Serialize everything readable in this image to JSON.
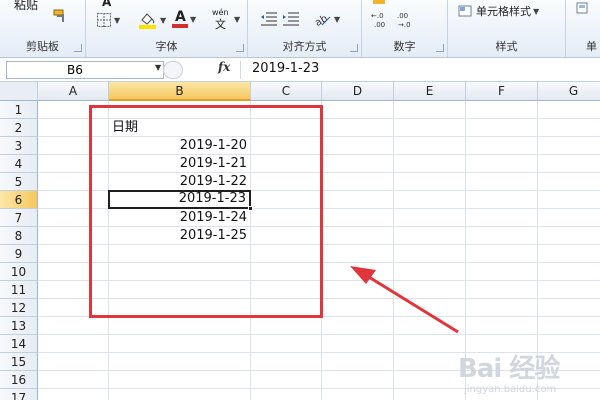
{
  "ribbon": {
    "paste_label": "粘贴",
    "groups": {
      "clipboard": "剪贴板",
      "font": "字体",
      "alignment": "对齐方式",
      "number": "数字",
      "styles": "样式",
      "cells_partial": "单"
    },
    "cell_styles_label": "单元格样式",
    "font_sample_a": "A",
    "font_color_a": "A",
    "wen_label": "wén",
    "wen_char": "文",
    "colors": {
      "font_red": "#d32f2f",
      "fill_yellow": "#ffe100",
      "accent": "#2b579a"
    }
  },
  "formula_bar": {
    "name_box": "B6",
    "fx": "fx",
    "value": "2019-1-23"
  },
  "sheet": {
    "columns": [
      "A",
      "B",
      "C",
      "D",
      "E",
      "F",
      "G"
    ],
    "selected_column": "B",
    "rows": [
      "1",
      "2",
      "3",
      "4",
      "5",
      "6",
      "7",
      "8",
      "9",
      "10",
      "11",
      "12",
      "13",
      "14",
      "15",
      "16",
      "17"
    ],
    "selected_row": "6",
    "header_cell": "日期",
    "dates": [
      "2019-1-20",
      "2019-1-21",
      "2019-1-22",
      "2019-1-23",
      "2019-1-24",
      "2019-1-25"
    ],
    "active_cell": "B6"
  },
  "watermark": {
    "text": "Bai 经验",
    "url": "jingyan.baidu.com"
  }
}
